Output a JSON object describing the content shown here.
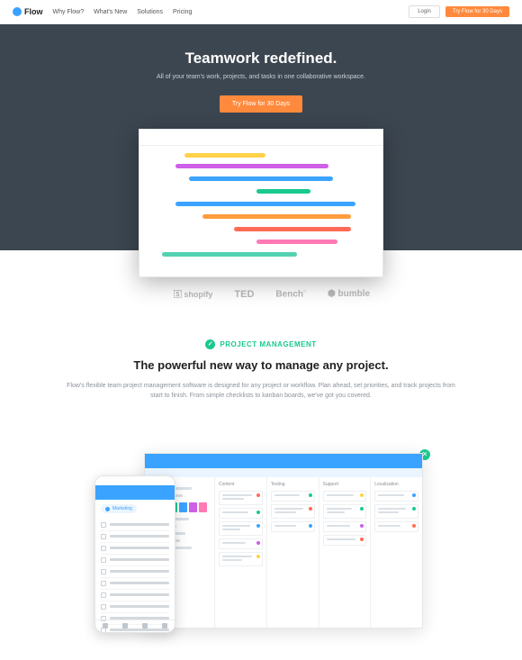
{
  "header": {
    "brand": "Flow",
    "nav": [
      "Why Flow?",
      "What's New",
      "Solutions",
      "Pricing"
    ],
    "login": "Login",
    "cta": "Try Flow for 30 Days"
  },
  "hero": {
    "title": "Teamwork redefined.",
    "subtitle": "All of your team's work, projects, and tasks in one collaborative workspace.",
    "cta": "Try Flow for 30 Days"
  },
  "logos": [
    "",
    "shopify",
    "TED",
    "Bench",
    "bumble"
  ],
  "feature": {
    "label": "PROJECT MANAGEMENT",
    "heading": "The powerful new way to manage any project.",
    "body": "Flow's flexible team project management software is designed for any project or workflow. Plan ahead, set priorities, and track projects from start to finish. From simple checklists to kanban boards, we've got you covered."
  },
  "mock": {
    "phone_badge": "Marketing",
    "columns": [
      "Content",
      "Testing",
      "Support",
      "Localization"
    ]
  },
  "colors": {
    "accent": "#3aa3ff",
    "cta": "#ff8a3d",
    "success": "#1ac98e",
    "gantt": [
      "#ffd24a",
      "#cf5ee8",
      "#3aa3ff",
      "#ff7d55",
      "#1ac98e",
      "#ffb43d",
      "#ff7ab5",
      "#54d1b1"
    ]
  }
}
